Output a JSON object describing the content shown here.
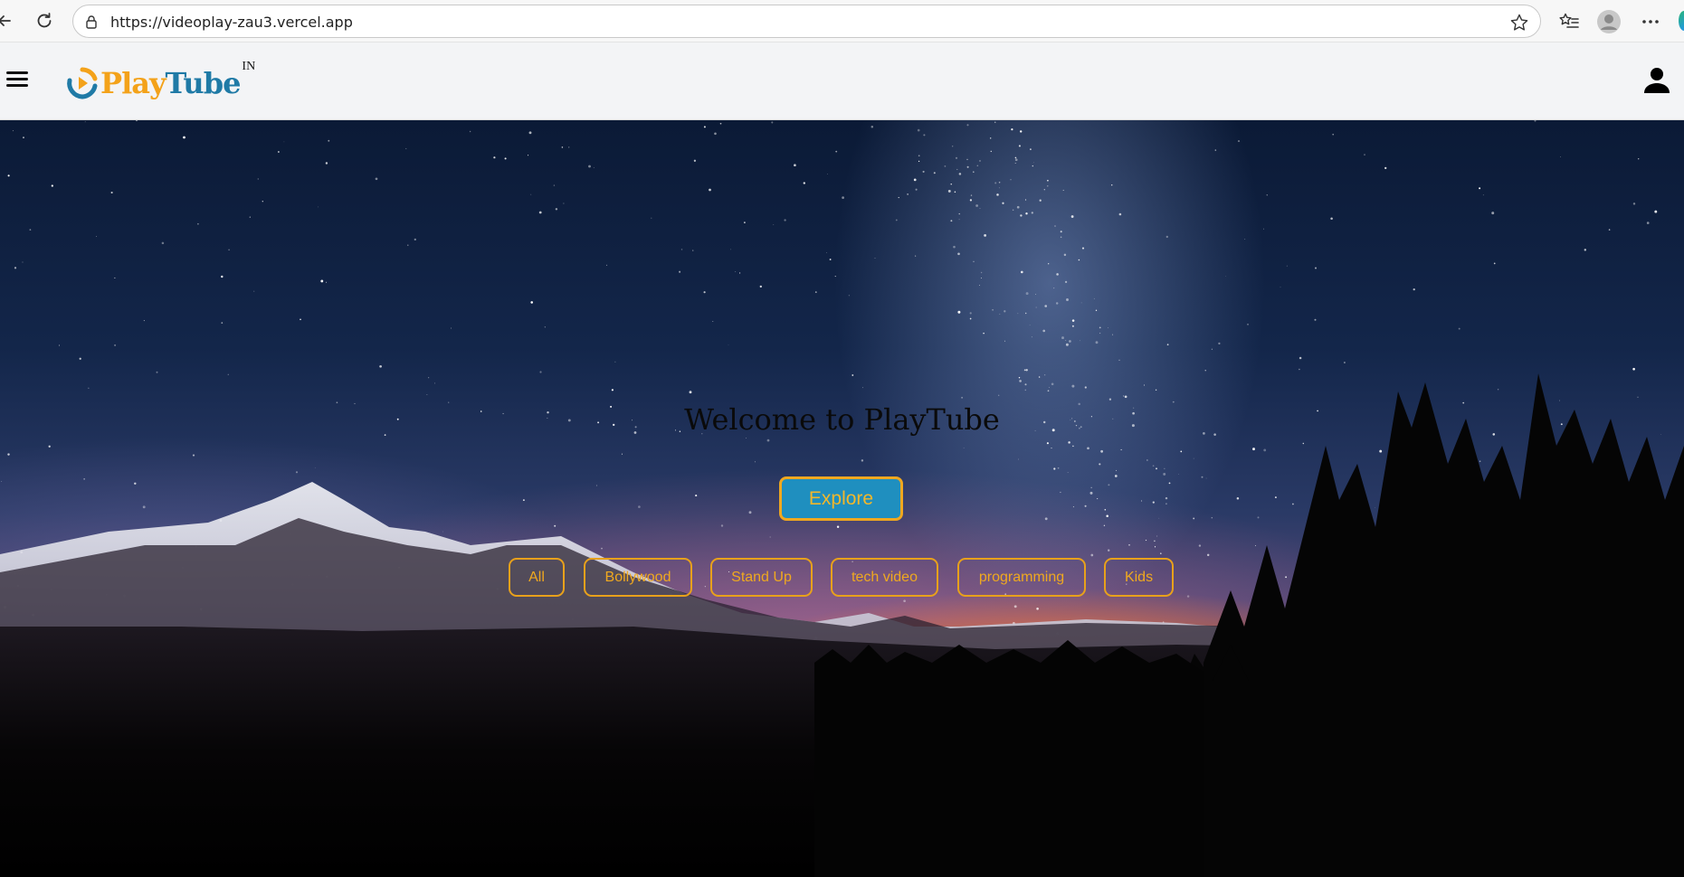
{
  "browser": {
    "url": "https://videoplay-zau3.vercel.app"
  },
  "header": {
    "logo_play": "Play",
    "logo_tube": "Tube",
    "logo_superscript": "IN"
  },
  "hero": {
    "title": "Welcome to PlayTube",
    "explore_label": "Explore",
    "categories": [
      {
        "label": "All"
      },
      {
        "label": "Bollywood"
      },
      {
        "label": "Stand Up"
      },
      {
        "label": "tech video"
      },
      {
        "label": "programming"
      },
      {
        "label": "Kids"
      }
    ]
  },
  "colors": {
    "accent_orange": "#f0a81f",
    "explore_blue": "#1f8fbf",
    "logo_blue": "#1f7aa6",
    "logo_orange": "#f3a21a"
  },
  "icons": [
    "back-arrow-icon",
    "reload-icon",
    "lock-icon",
    "star-icon",
    "favorites-list-icon",
    "profile-icon",
    "more-icon",
    "hamburger-menu-icon",
    "playtube-logo-icon",
    "user-icon"
  ]
}
